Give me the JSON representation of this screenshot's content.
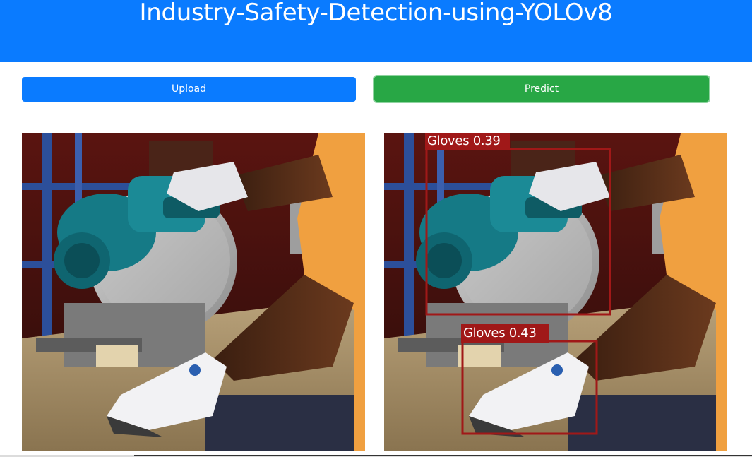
{
  "header": {
    "title": "Industry-Safety-Detection-using-YOLOv8",
    "background_color": "#0a7bff"
  },
  "actions": {
    "upload_label": "Upload",
    "predict_label": "Predict",
    "upload_color": "#0a7bff",
    "predict_color": "#28a745"
  },
  "images": {
    "input": {
      "description_icon": "uploaded-image"
    },
    "output": {
      "description_icon": "prediction-image",
      "detections": [
        {
          "label": "Gloves 0.39",
          "class": "Gloves",
          "confidence": 0.39
        },
        {
          "label": "Gloves 0.43",
          "class": "Gloves",
          "confidence": 0.43
        }
      ],
      "box_color": "#a01818"
    }
  }
}
